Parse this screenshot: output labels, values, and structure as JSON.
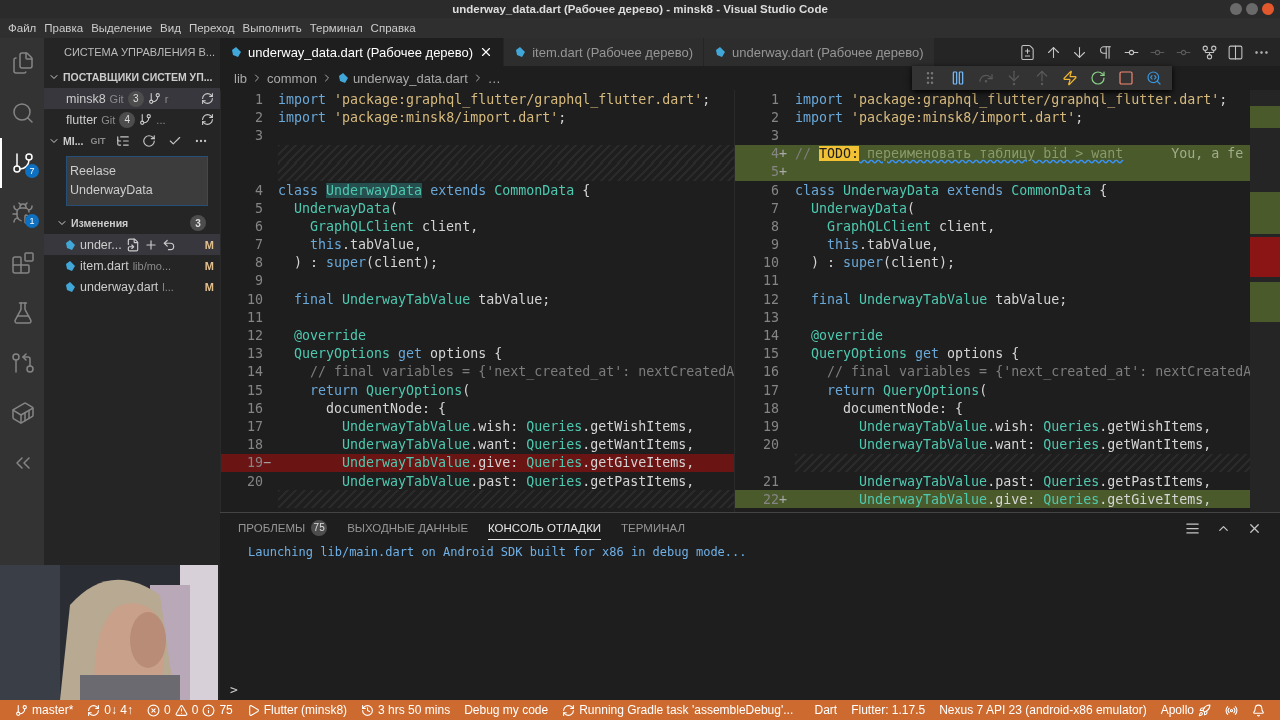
{
  "window": {
    "title": "underway_data.dart (Рабочее дерево) - minsk8 - Visual Studio Code"
  },
  "menu": [
    "Файл",
    "Правка",
    "Выделение",
    "Вид",
    "Переход",
    "Выполнить",
    "Терминал",
    "Справка"
  ],
  "activity_bar": [
    {
      "kind": "explorer",
      "selected": false
    },
    {
      "kind": "search",
      "selected": false
    },
    {
      "kind": "scm",
      "selected": true,
      "badge": "7"
    },
    {
      "kind": "debug",
      "selected": false,
      "badge": "1"
    },
    {
      "kind": "extensions",
      "selected": false
    },
    {
      "kind": "testing",
      "selected": false
    },
    {
      "kind": "git-graph",
      "selected": false
    },
    {
      "kind": "docker",
      "selected": false
    },
    {
      "kind": "flutter",
      "selected": false
    }
  ],
  "sidebar": {
    "title": "СИСТЕМА УПРАВЛЕНИЯ В...",
    "providers_title": "ПОСТАВЩИКИ СИСТЕМ УП...",
    "repositories": [
      {
        "name": "minsk8",
        "type": "Git",
        "count": "3",
        "branch": "r",
        "selected": true
      },
      {
        "name": "flutter",
        "type": "Git",
        "count": "4",
        "branch": "...",
        "selected": false
      }
    ],
    "repo_section": {
      "name": "MI...",
      "type": "GIT"
    },
    "commit_message": "Reelase\nUnderwayData",
    "changes": {
      "title": "Изменения",
      "count": "3",
      "files": [
        {
          "name": "under...",
          "status": "M",
          "selected": true
        },
        {
          "name": "item.dart",
          "path": "lib/mo...",
          "status": "M",
          "selected": false
        },
        {
          "name": "underway.dart",
          "path": "l...",
          "status": "M",
          "selected": false
        }
      ]
    }
  },
  "tabs": [
    {
      "label": "underway_data.dart (Рабочее дерево)",
      "selected": true
    },
    {
      "label": "item.dart (Рабочее дерево)",
      "selected": false
    },
    {
      "label": "underway.dart (Рабочее дерево)",
      "selected": false
    }
  ],
  "editor_actions": [
    {
      "kind": "open-changes",
      "disabled": false
    },
    {
      "kind": "previous-change",
      "disabled": false
    },
    {
      "kind": "next-change",
      "disabled": false
    },
    {
      "kind": "whitespace",
      "disabled": false
    },
    {
      "kind": "go-back",
      "disabled": false
    },
    {
      "kind": "commit",
      "disabled": true
    },
    {
      "kind": "go-forward",
      "disabled": true
    },
    {
      "kind": "git-graph",
      "disabled": false
    },
    {
      "kind": "split",
      "disabled": false
    },
    {
      "kind": "more",
      "disabled": false
    }
  ],
  "debug_toolbar": [
    {
      "kind": "grip",
      "disabled": false
    },
    {
      "kind": "pause",
      "disabled": false
    },
    {
      "kind": "step-over",
      "disabled": true
    },
    {
      "kind": "step-into",
      "disabled": true
    },
    {
      "kind": "step-out",
      "disabled": true
    },
    {
      "kind": "hot-reload",
      "disabled": false
    },
    {
      "kind": "restart",
      "disabled": false
    },
    {
      "kind": "stop",
      "disabled": false
    },
    {
      "kind": "inspector",
      "disabled": false
    }
  ],
  "breadcrumbs": [
    "lib",
    "common",
    "underway_data.dart",
    "…"
  ],
  "diff": {
    "left": [
      {
        "kind": "normal",
        "num": "1",
        "tokens": [
          {
            "kind": "kw",
            "text": "import"
          },
          {
            "kind": "str",
            "text": " 'package:graphql_flutter/graphql_flutter.dart'"
          },
          {
            "kind": "p",
            "text": ";"
          }
        ]
      },
      {
        "kind": "normal",
        "num": "2",
        "tokens": [
          {
            "kind": "kw",
            "text": "import"
          },
          {
            "kind": "str",
            "text": " 'package:minsk8/import.dart'"
          },
          {
            "kind": "p",
            "text": ";"
          }
        ]
      },
      {
        "kind": "normal",
        "num": "3"
      },
      {
        "kind": "filler"
      },
      {
        "kind": "filler"
      },
      {
        "kind": "normal",
        "num": "4",
        "tokens": [
          {
            "kind": "kw",
            "text": "class "
          },
          {
            "kind": "hl",
            "text": "UnderwayData"
          },
          {
            "kind": "kw",
            "text": " extends"
          },
          {
            "kind": "type",
            "text": " CommonData"
          },
          {
            "kind": "p",
            "text": " {"
          }
        ]
      },
      {
        "kind": "normal",
        "num": "5",
        "tokens": [
          {
            "kind": "type",
            "text": "  UnderwayData"
          },
          {
            "kind": "p",
            "text": "("
          }
        ]
      },
      {
        "kind": "normal",
        "num": "6",
        "tokens": [
          {
            "kind": "type",
            "text": "    GraphQLClient"
          },
          {
            "kind": "p",
            "text": " client,"
          }
        ]
      },
      {
        "kind": "normal",
        "num": "7",
        "tokens": [
          {
            "kind": "kw",
            "text": "    this"
          },
          {
            "kind": "p",
            "text": ".tabValue,"
          }
        ]
      },
      {
        "kind": "normal",
        "num": "8",
        "tokens": [
          {
            "kind": "p",
            "text": "  ) : "
          },
          {
            "kind": "kw",
            "text": "super"
          },
          {
            "kind": "p",
            "text": "(client);"
          }
        ]
      },
      {
        "kind": "normal",
        "num": "9"
      },
      {
        "kind": "normal",
        "num": "10",
        "tokens": [
          {
            "kind": "kw",
            "text": "  final"
          },
          {
            "kind": "type",
            "text": " UnderwayTabValue"
          },
          {
            "kind": "p",
            "text": " tabValue;"
          }
        ]
      },
      {
        "kind": "normal",
        "num": "11"
      },
      {
        "kind": "normal",
        "num": "12",
        "tokens": [
          {
            "kind": "ann",
            "text": "  @override"
          }
        ]
      },
      {
        "kind": "normal",
        "num": "13",
        "tokens": [
          {
            "kind": "type",
            "text": "  QueryOptions"
          },
          {
            "kind": "kw",
            "text": " get"
          },
          {
            "kind": "p",
            "text": " options {"
          }
        ]
      },
      {
        "kind": "normal",
        "num": "14",
        "tokens": [
          {
            "kind": "com",
            "text": "    // final variables = {'next_created_at': nextCreatedA"
          }
        ]
      },
      {
        "kind": "normal",
        "num": "15",
        "tokens": [
          {
            "kind": "kw",
            "text": "    return"
          },
          {
            "kind": "type",
            "text": " QueryOptions"
          },
          {
            "kind": "p",
            "text": "("
          }
        ]
      },
      {
        "kind": "normal",
        "num": "16",
        "tokens": [
          {
            "kind": "p",
            "text": "      documentNode: {"
          }
        ]
      },
      {
        "kind": "normal",
        "num": "17",
        "tokens": [
          {
            "kind": "type",
            "text": "        UnderwayTabValue"
          },
          {
            "kind": "p",
            "text": ".wish: "
          },
          {
            "kind": "type",
            "text": "Queries"
          },
          {
            "kind": "p",
            "text": ".getWishItems,"
          }
        ]
      },
      {
        "kind": "normal",
        "num": "18",
        "tokens": [
          {
            "kind": "type",
            "text": "        UnderwayTabValue"
          },
          {
            "kind": "p",
            "text": ".want: "
          },
          {
            "kind": "type",
            "text": "Queries"
          },
          {
            "kind": "p",
            "text": ".getWantItems,"
          }
        ]
      },
      {
        "kind": "removed",
        "num": "19",
        "marker": "−",
        "tokens": [
          {
            "kind": "type",
            "text": "        UnderwayTabValue"
          },
          {
            "kind": "p",
            "text": ".give: "
          },
          {
            "kind": "type",
            "text": "Queries"
          },
          {
            "kind": "p",
            "text": ".getGiveItems,"
          }
        ]
      },
      {
        "kind": "normal",
        "num": "20",
        "tokens": [
          {
            "kind": "type",
            "text": "        UnderwayTabValue"
          },
          {
            "kind": "p",
            "text": ".past: "
          },
          {
            "kind": "type",
            "text": "Queries"
          },
          {
            "kind": "p",
            "text": ".getPastItems,"
          }
        ]
      },
      {
        "kind": "filler"
      }
    ],
    "right": [
      {
        "kind": "normal",
        "num": "1",
        "tokens": [
          {
            "kind": "kw",
            "text": "import"
          },
          {
            "kind": "str",
            "text": " 'package:graphql_flutter/graphql_flutter.dart'"
          },
          {
            "kind": "p",
            "text": ";"
          }
        ]
      },
      {
        "kind": "normal",
        "num": "2",
        "tokens": [
          {
            "kind": "kw",
            "text": "import"
          },
          {
            "kind": "str",
            "text": " 'package:minsk8/import.dart'"
          },
          {
            "kind": "p",
            "text": ";"
          }
        ]
      },
      {
        "kind": "normal",
        "num": "3"
      },
      {
        "kind": "added",
        "num": "4",
        "marker": "+",
        "tokens": [
          {
            "kind": "com",
            "text": "// "
          },
          {
            "kind": "todo",
            "text": "TODO:"
          },
          {
            "kind": "squiggle",
            "text": " переименовать таблицу bid > want"
          }
        ],
        "blame": "You, a fe"
      },
      {
        "kind": "added",
        "num": "5",
        "marker": "+"
      },
      {
        "kind": "normal",
        "num": "6",
        "tokens": [
          {
            "kind": "kw",
            "text": "class"
          },
          {
            "kind": "type",
            "text": " UnderwayData"
          },
          {
            "kind": "kw",
            "text": " extends"
          },
          {
            "kind": "type",
            "text": " CommonData"
          },
          {
            "kind": "p",
            "text": " {"
          }
        ]
      },
      {
        "kind": "normal",
        "num": "7",
        "tokens": [
          {
            "kind": "type",
            "text": "  UnderwayData"
          },
          {
            "kind": "p",
            "text": "("
          }
        ]
      },
      {
        "kind": "normal",
        "num": "8",
        "tokens": [
          {
            "kind": "type",
            "text": "    GraphQLClient"
          },
          {
            "kind": "p",
            "text": " client,"
          }
        ]
      },
      {
        "kind": "normal",
        "num": "9",
        "tokens": [
          {
            "kind": "kw",
            "text": "    this"
          },
          {
            "kind": "p",
            "text": ".tabValue,"
          }
        ]
      },
      {
        "kind": "normal",
        "num": "10",
        "tokens": [
          {
            "kind": "p",
            "text": "  ) : "
          },
          {
            "kind": "kw",
            "text": "super"
          },
          {
            "kind": "p",
            "text": "(client);"
          }
        ]
      },
      {
        "kind": "normal",
        "num": "11"
      },
      {
        "kind": "normal",
        "num": "12",
        "tokens": [
          {
            "kind": "kw",
            "text": "  final"
          },
          {
            "kind": "type",
            "text": " UnderwayTabValue"
          },
          {
            "kind": "p",
            "text": " tabValue;"
          }
        ]
      },
      {
        "kind": "normal",
        "num": "13"
      },
      {
        "kind": "normal",
        "num": "14",
        "tokens": [
          {
            "kind": "ann",
            "text": "  @override"
          }
        ]
      },
      {
        "kind": "normal",
        "num": "15",
        "tokens": [
          {
            "kind": "type",
            "text": "  QueryOptions"
          },
          {
            "kind": "kw",
            "text": " get"
          },
          {
            "kind": "p",
            "text": " options {"
          }
        ]
      },
      {
        "kind": "normal",
        "num": "16",
        "tokens": [
          {
            "kind": "com",
            "text": "    // final variables = {'next_created_at': nextCreatedA"
          }
        ]
      },
      {
        "kind": "normal",
        "num": "17",
        "tokens": [
          {
            "kind": "kw",
            "text": "    return"
          },
          {
            "kind": "type",
            "text": " QueryOptions"
          },
          {
            "kind": "p",
            "text": "("
          }
        ]
      },
      {
        "kind": "normal",
        "num": "18",
        "tokens": [
          {
            "kind": "p",
            "text": "      documentNode: {"
          }
        ]
      },
      {
        "kind": "normal",
        "num": "19",
        "tokens": [
          {
            "kind": "type",
            "text": "        UnderwayTabValue"
          },
          {
            "kind": "p",
            "text": ".wish: "
          },
          {
            "kind": "type",
            "text": "Queries"
          },
          {
            "kind": "p",
            "text": ".getWishItems,"
          }
        ]
      },
      {
        "kind": "normal",
        "num": "20",
        "tokens": [
          {
            "kind": "type",
            "text": "        UnderwayTabValue"
          },
          {
            "kind": "p",
            "text": ".want: "
          },
          {
            "kind": "type",
            "text": "Queries"
          },
          {
            "kind": "p",
            "text": ".getWantItems,"
          }
        ]
      },
      {
        "kind": "filler"
      },
      {
        "kind": "normal",
        "num": "21",
        "tokens": [
          {
            "kind": "type",
            "text": "        UnderwayTabValue"
          },
          {
            "kind": "p",
            "text": ".past: "
          },
          {
            "kind": "type",
            "text": "Queries"
          },
          {
            "kind": "p",
            "text": ".getPastItems,"
          }
        ]
      },
      {
        "kind": "added",
        "num": "22",
        "marker": "+",
        "tokens": [
          {
            "kind": "type",
            "text": "        UnderwayTabValue"
          },
          {
            "kind": "p",
            "text": ".give: "
          },
          {
            "kind": "type",
            "text": "Queries"
          },
          {
            "kind": "p",
            "text": ".getGiveItems,"
          }
        ]
      }
    ]
  },
  "panel": {
    "tabs": [
      {
        "label": "ПРОБЛЕМЫ",
        "badge": "75",
        "selected": false
      },
      {
        "label": "ВЫХОДНЫЕ ДАННЫЕ",
        "selected": false
      },
      {
        "label": "КОНСОЛЬ ОТЛАДКИ",
        "selected": true
      },
      {
        "label": "ТЕРМИНАЛ",
        "selected": false
      }
    ],
    "output": [
      "Launching lib/main.dart on Android SDK built for x86 in debug mode..."
    ],
    "prompt": ">"
  },
  "webcam": {
    "kind": "picture"
  },
  "status_bar": {
    "left": [
      {
        "kind": "branch",
        "text": "master*"
      },
      {
        "kind": "sync",
        "text": "0↓ 4↑"
      },
      {
        "kind": "problems",
        "errors": "0",
        "warnings": "0",
        "infos": "75"
      },
      {
        "kind": "run",
        "text": "Flutter (minsk8)"
      },
      {
        "kind": "time",
        "text": "3 hrs 50 mins"
      },
      {
        "kind": "text",
        "text": "Debug my code"
      },
      {
        "kind": "task",
        "text": "Running Gradle task 'assembleDebug'..."
      }
    ],
    "right": [
      {
        "kind": "text",
        "text": "Dart"
      },
      {
        "kind": "text",
        "text": "Flutter: 1.17.5"
      },
      {
        "kind": "text",
        "text": "Nexus 7 API 23 (android-x86 emulator)"
      },
      {
        "kind": "apollo",
        "text": "Apollo"
      },
      {
        "kind": "broadcast"
      },
      {
        "kind": "bell"
      }
    ]
  }
}
